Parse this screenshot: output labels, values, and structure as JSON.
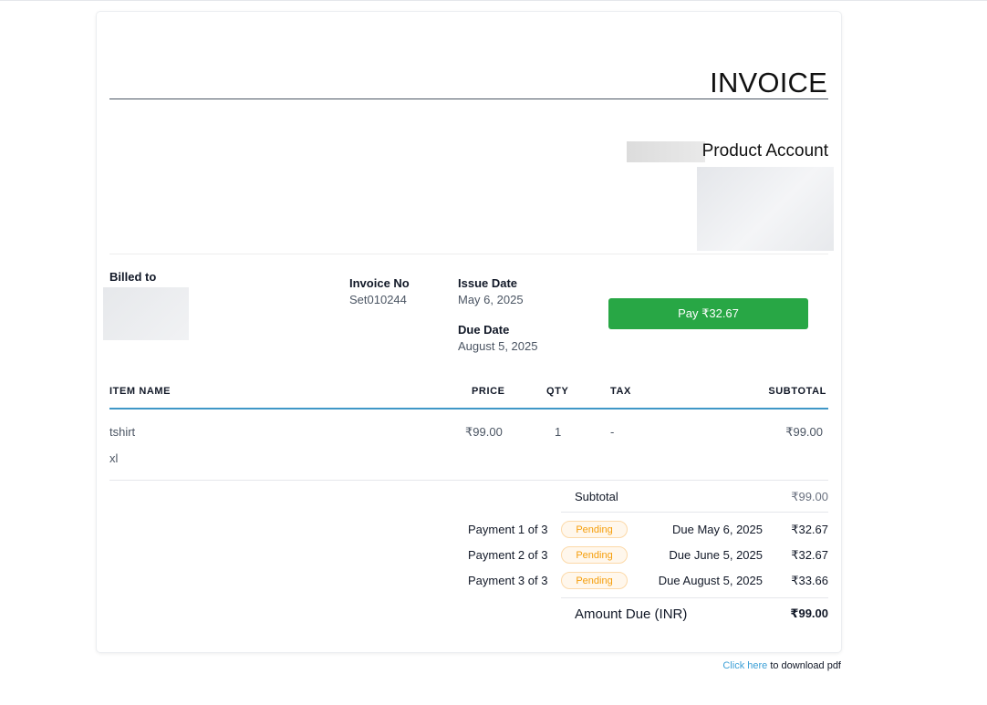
{
  "invoice": {
    "title": "INVOICE",
    "company_name": "Product Account",
    "billed_to_label": "Billed to",
    "invoice_no_label": "Invoice No",
    "invoice_no": "Set010244",
    "issue_date_label": "Issue Date",
    "issue_date": "May 6, 2025",
    "due_date_label": "Due Date",
    "due_date": "August 5, 2025",
    "pay_button_label": "Pay ₹32.67",
    "pay_button_color": "#28a745"
  },
  "table": {
    "headers": {
      "item": "ITEM NAME",
      "price": "PRICE",
      "qty": "QTY",
      "tax": "TAX",
      "subtotal": "SUBTOTAL"
    },
    "items": [
      {
        "name": "tshirt",
        "variant": "xl",
        "price": "₹99.00",
        "qty": "1",
        "tax": "-",
        "subtotal": "₹99.00"
      }
    ]
  },
  "summary": {
    "subtotal_label": "Subtotal",
    "subtotal": "₹99.00",
    "payments": [
      {
        "label": "Payment 1 of 3",
        "status": "Pending",
        "due": "Due May 6, 2025",
        "amount": "₹32.67"
      },
      {
        "label": "Payment 2 of 3",
        "status": "Pending",
        "due": "Due June 5, 2025",
        "amount": "₹32.67"
      },
      {
        "label": "Payment 3 of 3",
        "status": "Pending",
        "due": "Due August 5, 2025",
        "amount": "₹33.66"
      }
    ],
    "amount_due_label": "Amount Due (INR)",
    "amount_due": "₹99.00"
  },
  "footer": {
    "download_link": "Click here",
    "download_text": " to download pdf"
  },
  "colors": {
    "accent_rule": "#3f97c7",
    "pending_badge": "#f59e0b",
    "link": "#3b9fd6"
  }
}
